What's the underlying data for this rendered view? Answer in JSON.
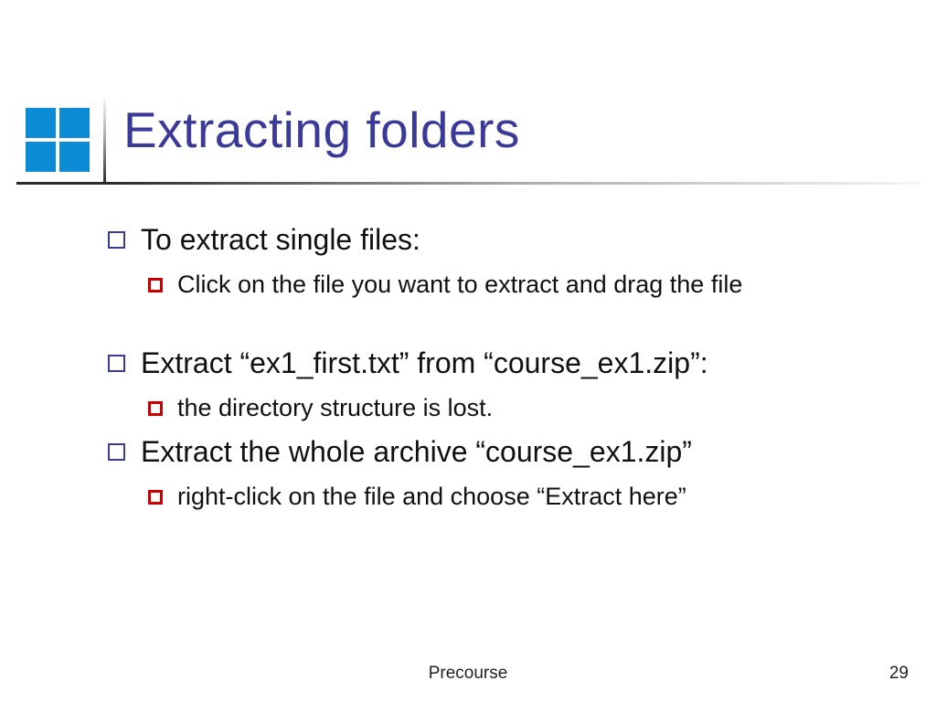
{
  "title": "Extracting folders",
  "bullets": {
    "b1": "To extract single files:",
    "b1a": "Click on the file you want to extract and drag the file",
    "b2": "Extract “ex1_first.txt” from “course_ex1.zip”:",
    "b2a": "the directory structure is lost.",
    "b3": "Extract the whole archive “course_ex1.zip”",
    "b3a": "right-click on the file and choose “Extract here”"
  },
  "footer": {
    "label": "Precourse",
    "page": "29"
  }
}
